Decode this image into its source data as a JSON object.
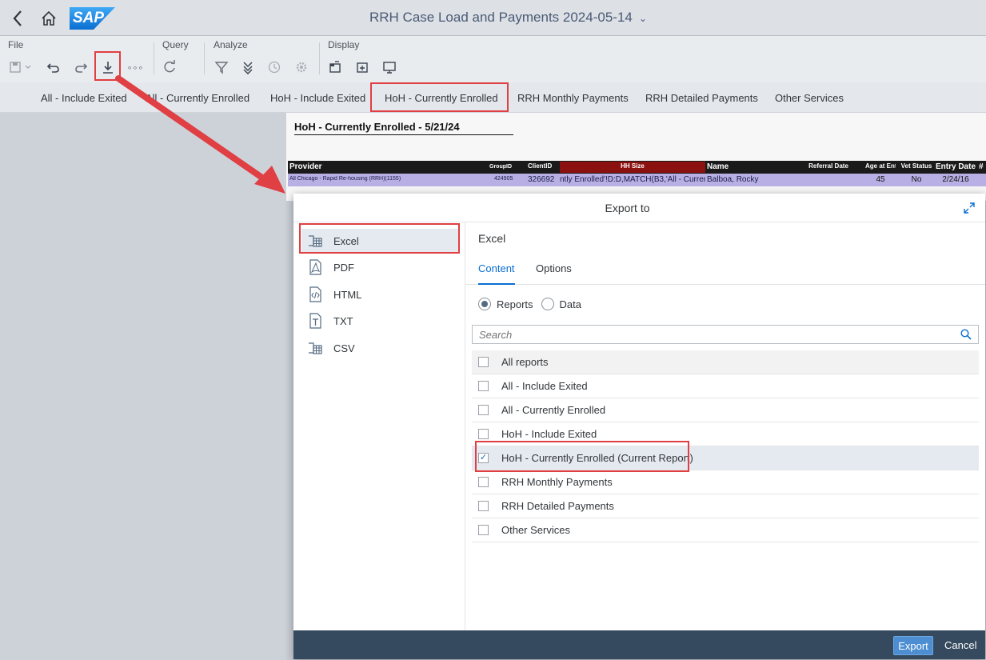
{
  "shell": {
    "title": "RRH Case Load and Payments 2024-05-14",
    "logo_text": "SAP",
    "title_chevron": "⌄"
  },
  "toolbar": {
    "groups": [
      {
        "label": "File"
      },
      {
        "label": "Query"
      },
      {
        "label": "Analyze"
      },
      {
        "label": "Display"
      }
    ],
    "more_label": "∘∘∘"
  },
  "tabs": [
    {
      "label": "All - Include Exited"
    },
    {
      "label": "All - Currently Enrolled"
    },
    {
      "label": "HoH - Include Exited"
    },
    {
      "label": "HoH - Currently Enrolled"
    },
    {
      "label": "RRH Monthly Payments"
    },
    {
      "label": "RRH Detailed Payments"
    },
    {
      "label": "Other Services"
    }
  ],
  "report": {
    "title": "HoH - Currently Enrolled - 5/21/24",
    "columns": [
      "Provider",
      "GroupID",
      "ClientID",
      "HH Size",
      "Name",
      "Referral Date",
      "Age at Entry",
      "Vet Status",
      "Entry Date",
      "#"
    ],
    "row": [
      "All Chicago - Rapid Re-housing (RRH)(1155)",
      "424905",
      "326692",
      "ntly Enrolled'!D:D,MATCH(B3,'All - Curren",
      "Balboa, Rocky",
      "",
      "45",
      "No",
      "2/24/16",
      ""
    ]
  },
  "dialog": {
    "title": "Export to",
    "formats": [
      {
        "label": "Excel",
        "icon": "excel-icon"
      },
      {
        "label": "PDF",
        "icon": "pdf-icon"
      },
      {
        "label": "HTML",
        "icon": "html-icon"
      },
      {
        "label": "TXT",
        "icon": "txt-icon"
      },
      {
        "label": "CSV",
        "icon": "csv-icon"
      }
    ],
    "content_title": "Excel",
    "content_tabs": [
      {
        "label": "Content"
      },
      {
        "label": "Options"
      }
    ],
    "radios": [
      {
        "label": "Reports",
        "selected": true
      },
      {
        "label": "Data",
        "selected": false
      }
    ],
    "search_placeholder": "Search",
    "reports": [
      {
        "label": "All reports",
        "checked": false
      },
      {
        "label": "All - Include Exited",
        "checked": false
      },
      {
        "label": "All - Currently Enrolled",
        "checked": false
      },
      {
        "label": "HoH - Include Exited",
        "checked": false
      },
      {
        "label": "HoH - Currently Enrolled (Current Report)",
        "checked": true
      },
      {
        "label": "RRH Monthly Payments",
        "checked": false
      },
      {
        "label": "RRH Detailed Payments",
        "checked": false
      },
      {
        "label": "Other Services",
        "checked": false
      }
    ],
    "export_label": "Export",
    "cancel_label": "Cancel"
  },
  "colors": {
    "highlight": "#e03f44",
    "accent": "#0a6ed1",
    "footer": "#354a5f",
    "report_row": "#b8b0e4"
  }
}
